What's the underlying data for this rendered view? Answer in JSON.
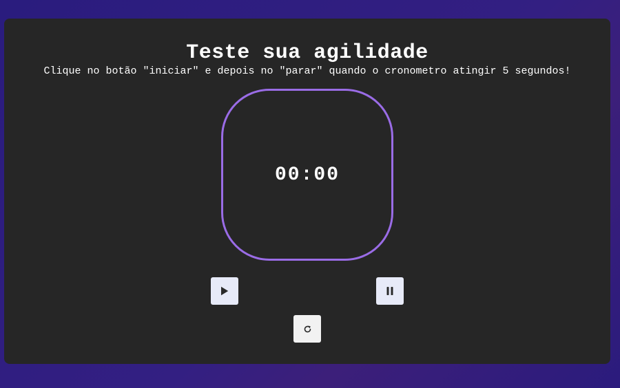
{
  "title": "Teste sua agilidade",
  "subtitle": "Clique no botão \"iniciar\" e depois no \"parar\" quando o cronometro atingir 5 segundos!",
  "timer": {
    "display": "00:00"
  },
  "buttons": {
    "start_icon": "play-icon",
    "stop_icon": "pause-icon",
    "reset_icon": "reset-icon"
  },
  "colors": {
    "page_background": "#2b1b7d",
    "card_background": "#262626",
    "timer_border": "#9a6ce6",
    "button_background": "#e7eaf8"
  }
}
